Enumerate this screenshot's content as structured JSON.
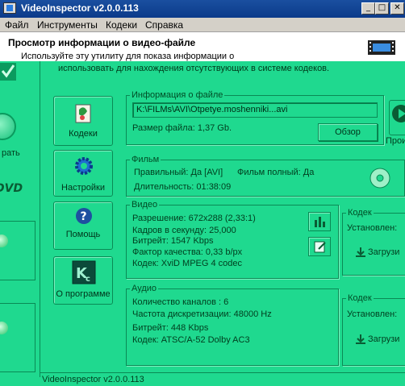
{
  "window": {
    "title": "VideoInspector v2.0.0.113"
  },
  "menu": [
    "Файл",
    "Инструменты",
    "Кодеки",
    "Справка"
  ],
  "header": {
    "title": "Просмотр информации о видео-файле",
    "subtitle": "Используйте эту утилиту для показа информации о",
    "subtitle2": "использовать для нахождения отсутствующих в системе кодеков."
  },
  "left_strip": {
    "label_top": "рать"
  },
  "nav": {
    "codecs": "Кодеки",
    "settings": "Настройки",
    "help": "Помощь",
    "about": "О программе"
  },
  "file": {
    "group_label": "Информация о файле",
    "path": "K:\\FILMs\\AVI\\Otpetye.moshenniki...avi",
    "size_label": "Размер файла: 1,37 Gb.",
    "browse": "Обзор",
    "right_btn": "Прои"
  },
  "film": {
    "group_label": "Фильм",
    "correct": "Правильный: Да [AVI]",
    "full": "Фильм полный: Да",
    "duration": "Длительность: 01:38:09"
  },
  "video": {
    "group_label": "Видео",
    "resolution": "Разрешение: 672x288 (2,33:1)",
    "fps": "Кадров в секунду: 25,000",
    "bitrate": "Битрейт: 1547 Kbps",
    "quality": "Фактор качества: 0,33 b/px",
    "codec": "Кодек: XviD MPEG 4 codec"
  },
  "video_codec": {
    "group_label": "Кодек",
    "installed": "Установлен:",
    "download": "Загрузи"
  },
  "audio": {
    "group_label": "Аудио",
    "channels": "Количество каналов : 6",
    "rate": "Частота дискретизации: 48000 Hz",
    "bitrate": "Битрейт: 448 Kbps",
    "codec": "Кодек: ATSC/A-52 Dolby AC3"
  },
  "audio_codec": {
    "group_label": "Кодек",
    "installed": "Установлен:",
    "download": "Загрузи"
  },
  "status": {
    "text": "VideoInspector v2.0.0.113"
  }
}
